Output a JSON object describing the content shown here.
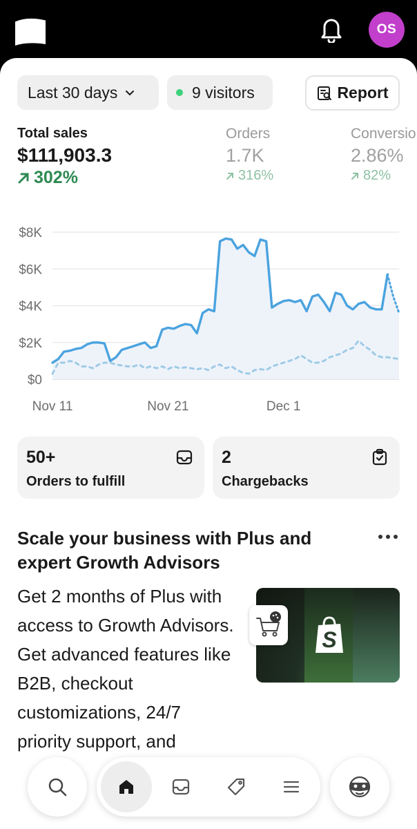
{
  "header": {
    "avatar_initials": "OS",
    "avatar_color": "#c13fcb"
  },
  "filters": {
    "date_range": "Last 30 days",
    "visitors": "9 visitors",
    "report_label": "Report"
  },
  "metrics": [
    {
      "label": "Total sales",
      "value": "$111,903.3",
      "change": "302%"
    },
    {
      "label": "Orders",
      "value": "1.7K",
      "change": "316%"
    },
    {
      "label": "Conversion",
      "value": "2.86%",
      "change": "82%"
    }
  ],
  "chart_data": {
    "type": "line",
    "y_ticks": [
      "$8K",
      "$6K",
      "$4K",
      "$2K",
      "$0"
    ],
    "x_ticks": [
      "Nov 11",
      "Nov 21",
      "Dec 1"
    ],
    "ylim": [
      0,
      8000
    ],
    "x": [
      11,
      11.5,
      12,
      12.5,
      13,
      13.5,
      14,
      14.5,
      15,
      15.5,
      16,
      16.5,
      17,
      17.5,
      18,
      18.5,
      19,
      19.5,
      20,
      20.5,
      21,
      21.5,
      22,
      22.5,
      23,
      23.5,
      24,
      24.5,
      25,
      25.5,
      26,
      26.5,
      27,
      27.5,
      28,
      28.5,
      29,
      29.5,
      30,
      30.5,
      31,
      31.5,
      32,
      32.5,
      33,
      33.5,
      34,
      34.5,
      35,
      35.5,
      36,
      36.5,
      37,
      37.5,
      38,
      38.5,
      39,
      39.5,
      40,
      40.5,
      41
    ],
    "series": [
      {
        "values": [
          900,
          1100,
          1500,
          1550,
          1650,
          1700,
          1900,
          2000,
          2000,
          1950,
          1000,
          1200,
          1600,
          1700,
          1800,
          1900,
          2000,
          1700,
          1800,
          2700,
          2800,
          2750,
          2900,
          3000,
          2950,
          2500,
          3600,
          3800,
          3700,
          7500,
          7650,
          7600,
          7100,
          7300,
          6900,
          6700,
          7600,
          7500,
          3900,
          4100,
          4250,
          4300,
          4200,
          4300,
          3700,
          4500,
          4600,
          4200,
          3700,
          4700,
          4600,
          4000,
          3800,
          4100,
          4200,
          3900,
          3800,
          3800,
          5700,
          4500,
          3600
        ],
        "dashed_tail_from_index": 58
      },
      {
        "values": [
          300,
          900,
          900,
          1000,
          900,
          700,
          700,
          600,
          800,
          900,
          900,
          800,
          750,
          700,
          700,
          800,
          600,
          700,
          600,
          700,
          550,
          700,
          600,
          650,
          600,
          550,
          600,
          500,
          700,
          800,
          600,
          700,
          500,
          350,
          300,
          500,
          550,
          500,
          700,
          800,
          900,
          1000,
          1100,
          1300,
          1100,
          900,
          900,
          1000,
          1200,
          1300,
          1400,
          1600,
          1700,
          2100,
          1800,
          1600,
          1300,
          1200,
          1200,
          1150,
          1100
        ],
        "style": "dashed"
      }
    ]
  },
  "cards": [
    {
      "number": "50+",
      "label": "Orders to fulfill"
    },
    {
      "number": "2",
      "label": "Chargebacks"
    }
  ],
  "promo": {
    "title": "Scale your business with Plus and expert Growth Advisors",
    "body": "Get 2 months of Plus with access to Growth Advisors. Get advanced features like B2B, checkout customizations, 24/7 priority support, and"
  }
}
